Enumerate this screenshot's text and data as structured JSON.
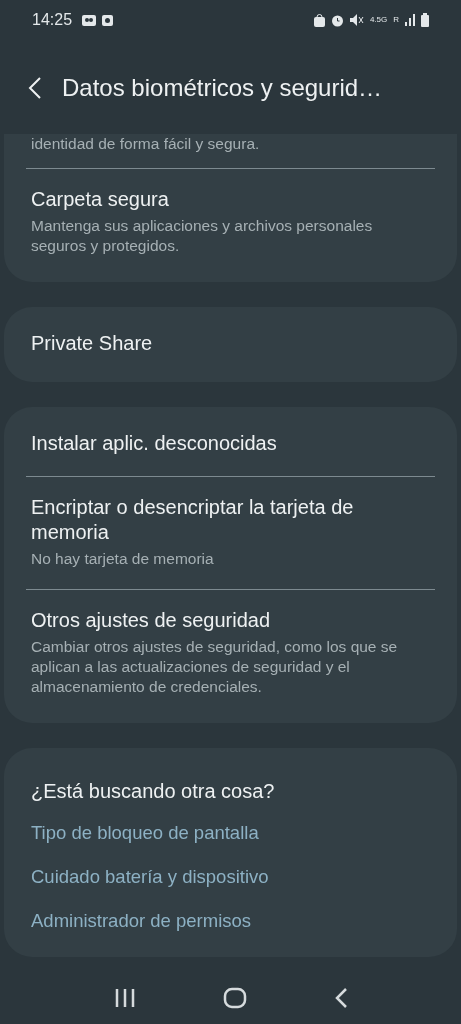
{
  "status_bar": {
    "time": "14:25",
    "network": "4.5G",
    "roaming": "R"
  },
  "header": {
    "title": "Datos biométricos y segurid…"
  },
  "cards": [
    {
      "items": [
        {
          "kind": "partial",
          "subtitle": "identidad de forma fácil y segura."
        },
        {
          "kind": "item",
          "title": "Carpeta segura",
          "subtitle": "Mantenga sus aplicaciones y archivos personales seguros y protegidos."
        }
      ]
    },
    {
      "items": [
        {
          "kind": "item",
          "title": "Private Share"
        }
      ]
    },
    {
      "items": [
        {
          "kind": "item",
          "title": "Instalar aplic. desconocidas"
        },
        {
          "kind": "item",
          "title": "Encriptar o desencriptar la tarjeta de memoria",
          "subtitle": "No hay tarjeta de memoria"
        },
        {
          "kind": "item",
          "title": "Otros ajustes de seguridad",
          "subtitle": "Cambiar otros ajustes de seguridad, como los que se aplican a las actualizaciones de seguridad y el almacenamiento de credenciales."
        }
      ]
    }
  ],
  "suggestions": {
    "title": "¿Está buscando otra cosa?",
    "links": [
      "Tipo de bloqueo de pantalla",
      "Cuidado batería y dispositivo",
      "Administrador de permisos"
    ]
  }
}
